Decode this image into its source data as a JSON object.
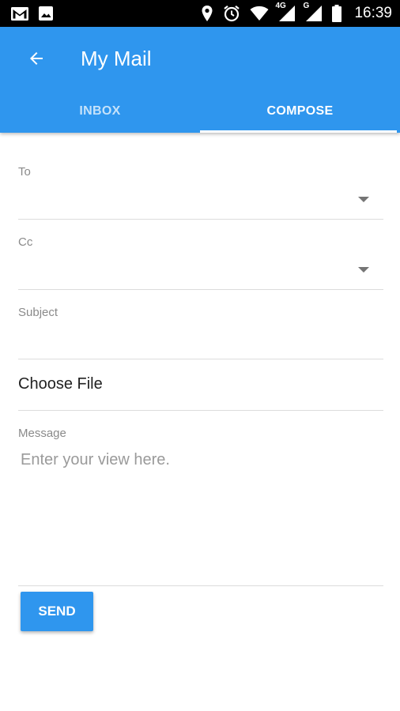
{
  "status_bar": {
    "time": "16:39",
    "network_label_1": "4G",
    "network_label_2": "G",
    "left_icons": [
      "gmail-icon",
      "image-icon"
    ],
    "right_icons": [
      "location-icon",
      "alarm-icon",
      "wifi-icon",
      "signal-icon",
      "signal-icon",
      "battery-icon"
    ]
  },
  "app_bar": {
    "title": "My Mail",
    "back_icon": "arrow-left-icon",
    "background": "#2f96ee"
  },
  "tabs": [
    {
      "label": "INBOX",
      "active": false
    },
    {
      "label": "COMPOSE",
      "active": true
    }
  ],
  "form": {
    "to": {
      "label": "To",
      "value": ""
    },
    "cc": {
      "label": "Cc",
      "value": ""
    },
    "subject": {
      "label": "Subject",
      "value": ""
    },
    "file": {
      "label": "Choose File"
    },
    "message": {
      "label": "Message",
      "placeholder": "Enter your view here.",
      "value": ""
    }
  },
  "send_button": {
    "label": "SEND"
  }
}
